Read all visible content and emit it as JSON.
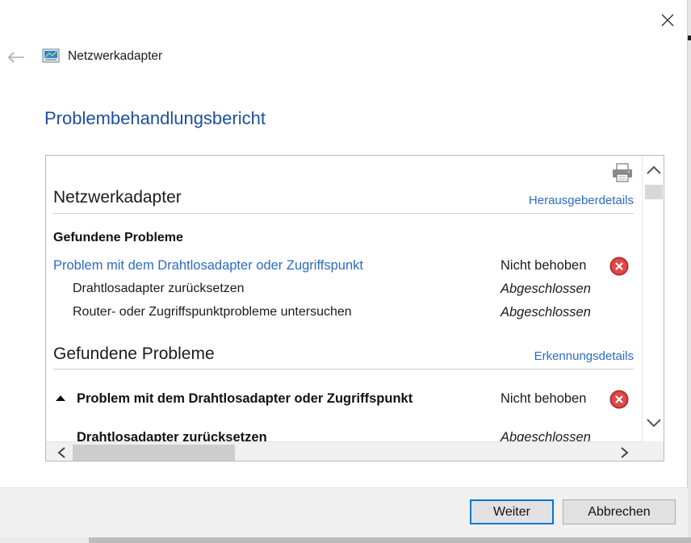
{
  "window": {
    "title": "Netzwerkadapter"
  },
  "page": {
    "heading": "Problembehandlungsbericht"
  },
  "report": {
    "section1": {
      "title": "Netzwerkadapter",
      "link": "Herausgeberdetails",
      "found_heading": "Gefundene Probleme",
      "problem": {
        "label": "Problem mit dem Drahtlosadapter oder Zugriffspunkt",
        "status": "Nicht behoben"
      },
      "steps": [
        {
          "label": "Drahtlosadapter zurücksetzen",
          "status": "Abgeschlossen"
        },
        {
          "label": "Router- oder Zugriffspunktprobleme untersuchen",
          "status": "Abgeschlossen"
        }
      ]
    },
    "section2": {
      "title": "Gefundene Probleme",
      "link": "Erkennungsdetails",
      "problem": {
        "label": "Problem mit dem Drahtlosadapter oder Zugriffspunkt",
        "status": "Nicht behoben"
      },
      "step": {
        "label": "Drahtlosadapter zurücksetzen",
        "status": "Abgeschlossen"
      }
    }
  },
  "buttons": {
    "next": "Weiter",
    "cancel": "Abbrechen"
  },
  "colors": {
    "accent_blue": "#1c4ea0",
    "link_blue": "#2b6bc5",
    "error_red": "#d03a3a",
    "primary_border": "#0078d7"
  }
}
